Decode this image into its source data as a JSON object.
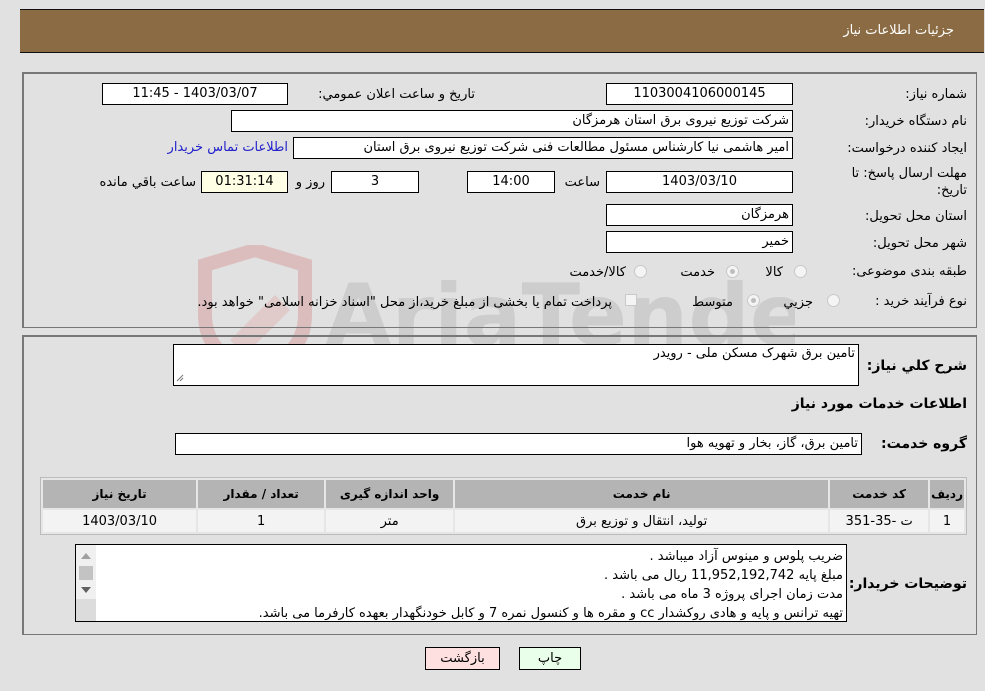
{
  "header": {
    "title": "جزئیات اطلاعات نیاز"
  },
  "form": {
    "need_number": {
      "label": "شماره نیاز:",
      "value": "1103004106000145"
    },
    "announce_datetime": {
      "label": "تاریخ و ساعت اعلان عمومي:",
      "value": "1403/03/07 - 11:45"
    },
    "buyer_org": {
      "label": "نام دستگاه خریدار:",
      "value": "شرکت توزیع نیروی برق استان هرمزگان"
    },
    "requester": {
      "label": "ایجاد کننده درخواست:",
      "value": "امیر هاشمی نیا کارشناس مسئول مطالعات فنی شرکت توزیع نیروی برق استان"
    },
    "contact_link": "اطلاعات تماس خریدار",
    "deadline": {
      "label_line1": "مهلت ارسال پاسخ: تا",
      "label_line2": "تاریخ:",
      "date": "1403/03/10",
      "time_label": "ساعت",
      "time": "14:00",
      "days": "3",
      "days_label": "روز و",
      "remaining": "01:31:14",
      "remaining_label": "ساعت باقي مانده"
    },
    "province": {
      "label": "استان محل تحویل:",
      "value": "هرمزگان"
    },
    "city": {
      "label": "شهر محل تحویل:",
      "value": "خمیر"
    },
    "category": {
      "label": "طبقه بندی موضوعی:",
      "options": [
        "کالا",
        "خدمت",
        "کالا/خدمت"
      ],
      "selected": "خدمت"
    },
    "purchase_type": {
      "label": "نوع فرآیند خرید :",
      "options": [
        "جزيي",
        "متوسط"
      ],
      "selected": "متوسط",
      "treasury_note": "پرداخت تمام یا بخشی از مبلغ خرید،از محل \"اسناد خزانه اسلامی\" خواهد بود."
    }
  },
  "details": {
    "summary": {
      "label": "شرح کلي نیاز:",
      "value": "تامین برق شهرک مسکن ملی - رویدر"
    },
    "services_title": "اطلاعات خدمات مورد نیاز",
    "service_group": {
      "label": "گروه خدمت:",
      "value": "تامین برق، گاز، بخار و تهویه هوا"
    },
    "table": {
      "headers": [
        "ردیف",
        "کد خدمت",
        "نام خدمت",
        "واحد اندازه گیری",
        "تعداد / مقدار",
        "تاریخ نیاز"
      ],
      "rows": [
        [
          "1",
          "ت -35-351",
          "تولید، انتقال و توزیع برق",
          "متر",
          "1",
          "1403/03/10"
        ]
      ]
    },
    "buyer_notes": {
      "label": "توضیحات خریدار:",
      "lines": [
        "ضریب پلوس و مینوس آزاد میباشد .",
        "مبلغ پایه 11,952,192,742 ریال می باشد .",
        "مدت زمان اجرای پروژه 3 ماه می باشد .",
        "تهیه ترانس و پایه و هادی روکشدار cc و مقره ها و کنسول نمره 7 و کابل خودنگهدار بعهده کارفرما می باشد."
      ]
    }
  },
  "buttons": {
    "print": "چاپ",
    "back": "بازگشت"
  },
  "colors": {
    "header_bg": "#8b6b43",
    "print_bg": "#eaffea",
    "back_bg": "#ffe0e0",
    "remaining_bg": "#ffffe6",
    "link": "#2222cc"
  },
  "watermark_text": "AriaTender.neT"
}
